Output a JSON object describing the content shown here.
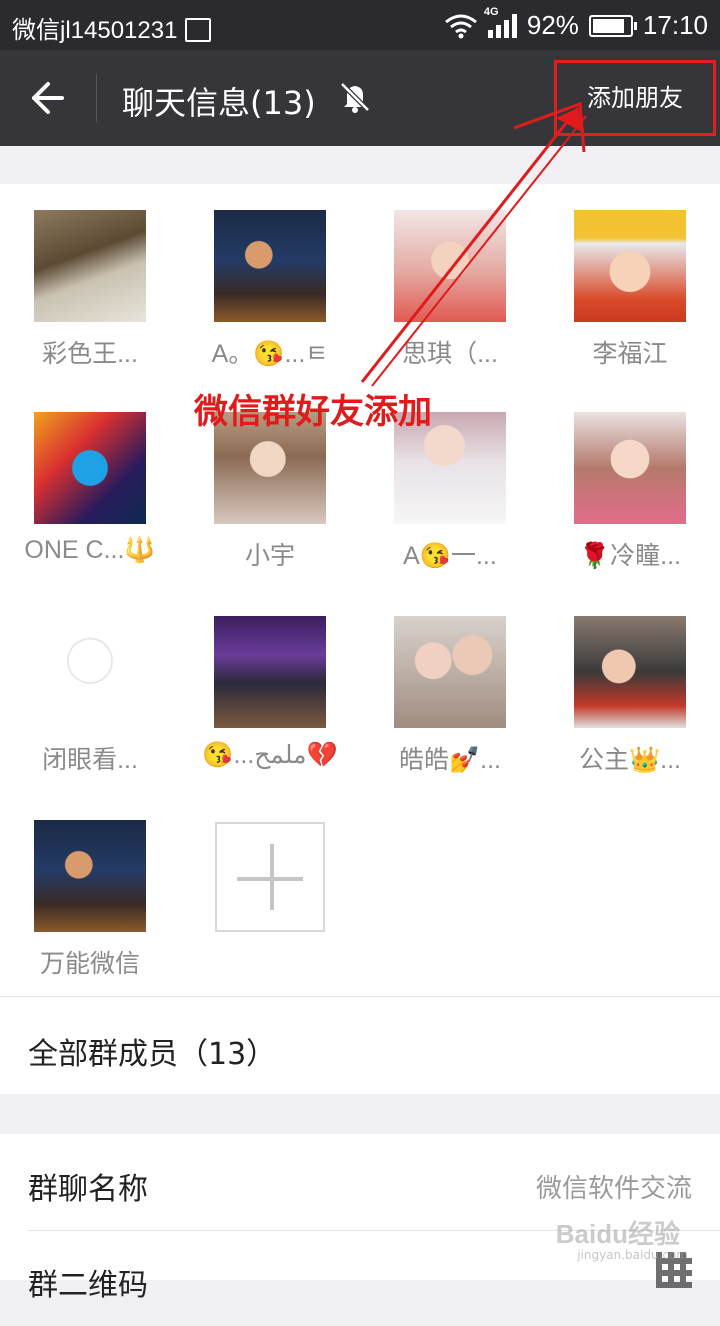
{
  "status_bar": {
    "carrier_text": "微信jl14501231",
    "network": "4G",
    "battery": "92%",
    "battery_level": 0.92,
    "time": "17:10"
  },
  "header": {
    "title": "聊天信息(13)",
    "add_friend_label": "添加朋友"
  },
  "annotation": {
    "text": "微信群好友添加",
    "color": "#e11b1b"
  },
  "members": [
    {
      "name": "彩色王...",
      "avatar": "photo-man-chair"
    },
    {
      "name": "A。😘...ㅌ",
      "avatar": "photo-singer-stage"
    },
    {
      "name": "思琪（...",
      "avatar": "photo-girl-pink"
    },
    {
      "name": "李福江",
      "avatar": "photo-baby-hat"
    },
    {
      "name": "ONE C...🔱",
      "avatar": "graphic-one-logo"
    },
    {
      "name": "小宇",
      "avatar": "photo-girl-hair"
    },
    {
      "name": "A😘一...",
      "avatar": "photo-girl-text"
    },
    {
      "name": "🌹冷瞳...",
      "avatar": "photo-girl-hand"
    },
    {
      "name": "闭眼看...",
      "avatar": "drawing-girl"
    },
    {
      "name": "😘...ملمح💔",
      "avatar": "photo-dj"
    },
    {
      "name": "皓皓💅...",
      "avatar": "photo-mother-child"
    },
    {
      "name": "公主👑...",
      "avatar": "photo-child-car"
    },
    {
      "name": "万能微信",
      "avatar": "photo-singer-stage"
    }
  ],
  "all_members_label": "全部群成员（13）",
  "settings": {
    "group_name_label": "群聊名称",
    "group_name_value": "微信软件交流",
    "qr_label": "群二维码"
  },
  "watermark": {
    "logo": "Baidu经验",
    "url": "jingyan.baidu.com"
  },
  "colors": {
    "titlebar": "#36353a",
    "statusbar": "#2b2a2f",
    "annotation": "#e11b1b",
    "page_bg": "#f0eff4"
  }
}
